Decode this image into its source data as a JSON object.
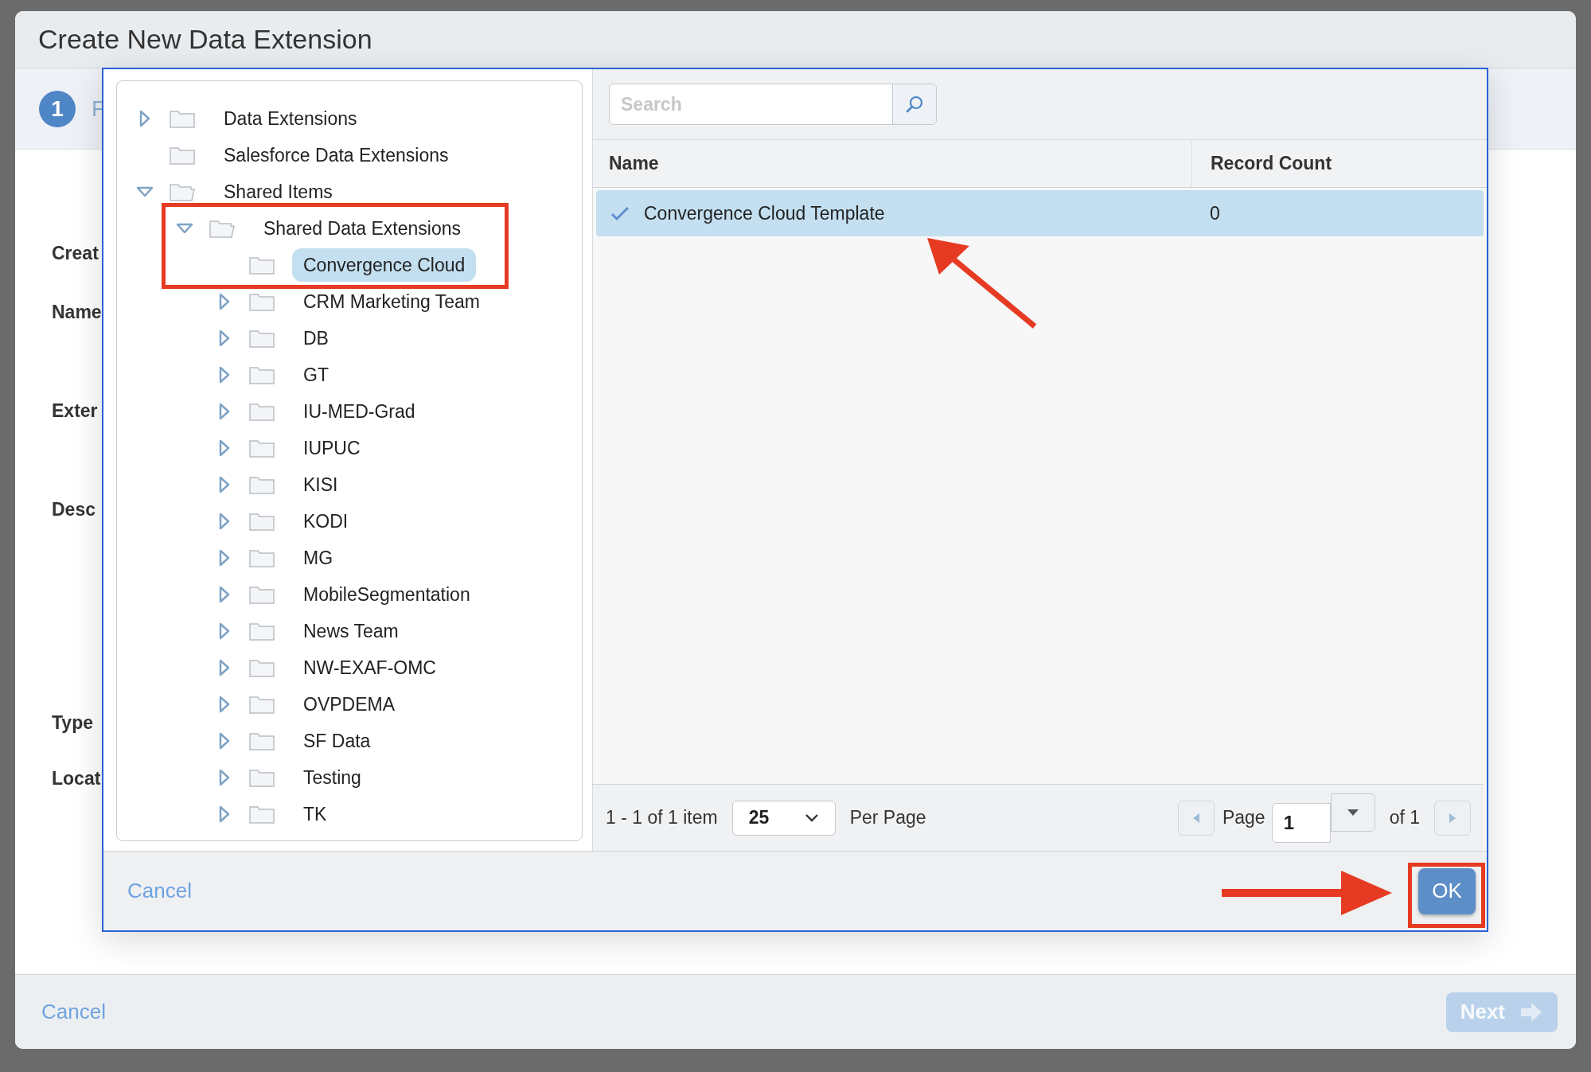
{
  "dialog": {
    "title": "Create New Data Extension",
    "step": {
      "number": "1",
      "label": "F"
    },
    "form_labels": [
      "Creat",
      "Name",
      "Exter",
      "Desc",
      "Type",
      "Locat"
    ],
    "footer": {
      "cancel": "Cancel",
      "next": "Next",
      "next_disabled": true
    }
  },
  "picker": {
    "tree": [
      {
        "label": "Data Extensions",
        "kind": "branch",
        "expanded": false,
        "selected": false
      },
      {
        "label": "Salesforce Data Extensions",
        "kind": "leaf",
        "selected": false
      },
      {
        "label": "Shared Items",
        "kind": "branch",
        "expanded": true,
        "selected": false,
        "children": [
          {
            "label": "Shared Data Extensions",
            "kind": "branch",
            "expanded": true,
            "selected": false,
            "children": [
              {
                "label": "Convergence Cloud",
                "kind": "leaf",
                "selected": true
              },
              {
                "label": "CRM Marketing Team",
                "kind": "branch",
                "expanded": false,
                "selected": false
              },
              {
                "label": "DB",
                "kind": "branch",
                "expanded": false,
                "selected": false
              },
              {
                "label": "GT",
                "kind": "branch",
                "expanded": false,
                "selected": false
              },
              {
                "label": "IU-MED-Grad",
                "kind": "branch",
                "expanded": false,
                "selected": false
              },
              {
                "label": "IUPUC",
                "kind": "branch",
                "expanded": false,
                "selected": false
              },
              {
                "label": "KISI",
                "kind": "branch",
                "expanded": false,
                "selected": false
              },
              {
                "label": "KODI",
                "kind": "branch",
                "expanded": false,
                "selected": false
              },
              {
                "label": "MG",
                "kind": "branch",
                "expanded": false,
                "selected": false
              },
              {
                "label": "MobileSegmentation",
                "kind": "branch",
                "expanded": false,
                "selected": false
              },
              {
                "label": "News Team",
                "kind": "branch",
                "expanded": false,
                "selected": false
              },
              {
                "label": "NW-EXAF-OMC",
                "kind": "branch",
                "expanded": false,
                "selected": false
              },
              {
                "label": "OVPDEMA",
                "kind": "branch",
                "expanded": false,
                "selected": false
              },
              {
                "label": "SF Data",
                "kind": "branch",
                "expanded": false,
                "selected": false
              },
              {
                "label": "Testing",
                "kind": "branch",
                "expanded": false,
                "selected": false
              },
              {
                "label": "TK",
                "kind": "branch",
                "expanded": false,
                "selected": false
              }
            ]
          }
        ]
      }
    ],
    "search": {
      "placeholder": "Search"
    },
    "table": {
      "columns": [
        "Name",
        "Record Count"
      ],
      "rows": [
        {
          "cells": [
            "Convergence Cloud Template",
            "0"
          ],
          "selected": true,
          "checked": true
        }
      ]
    },
    "pager": {
      "summary": "1 - 1 of 1 item",
      "per_page": "25",
      "per_page_label": "Per Page",
      "page_label": "Page",
      "page": "1",
      "of": "of 1"
    },
    "footer": {
      "cancel": "Cancel",
      "ok": "OK"
    }
  }
}
